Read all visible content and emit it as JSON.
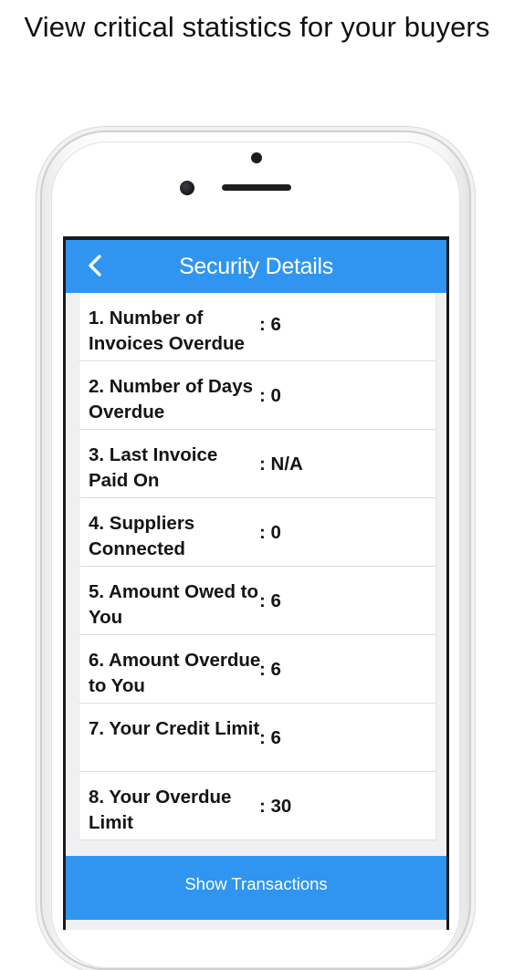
{
  "caption": "View critical statistics for your buyers",
  "navbar": {
    "title": "Security Details",
    "back_icon": "chevron-left-icon"
  },
  "details": [
    {
      "label": "1. Number of Invoices Overdue",
      "value": ": 6"
    },
    {
      "label": "2. Number of Days Overdue",
      "value": ": 0"
    },
    {
      "label": "3. Last Invoice Paid On",
      "value": ": N/A"
    },
    {
      "label": "4. Suppliers Connected",
      "value": ": 0"
    },
    {
      "label": "5. Amount Owed to You",
      "value": ": 6"
    },
    {
      "label": "6. Amount Overdue to You",
      "value": ": 6"
    },
    {
      "label": "7. Your Credit Limit",
      "value": ": 6"
    },
    {
      "label": "8. Your Overdue Limit",
      "value": ": 30"
    }
  ],
  "actions": {
    "show_transactions": "Show Transactions"
  },
  "colors": {
    "accent": "#2f95f0",
    "text": "#141414",
    "background": "#f0f0f3"
  }
}
